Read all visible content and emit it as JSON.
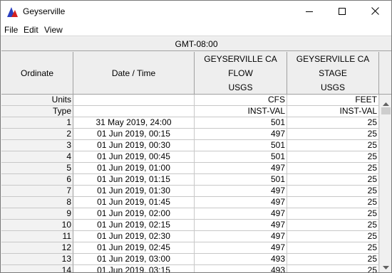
{
  "window": {
    "title": "Geyserville"
  },
  "menu": {
    "file": "File",
    "edit": "Edit",
    "view": "View"
  },
  "timezone": "GMT-08:00",
  "table": {
    "headers": {
      "ordinate": "Ordinate",
      "datetime": "Date / Time",
      "col2": [
        "GEYSERVILLE CA",
        "FLOW",
        "USGS"
      ],
      "col3": [
        "GEYSERVILLE CA",
        "STAGE",
        "USGS"
      ]
    },
    "units": {
      "label": "Units",
      "col2": "CFS",
      "col3": "FEET"
    },
    "type": {
      "label": "Type",
      "col2": "INST-VAL",
      "col3": "INST-VAL"
    },
    "rows": [
      {
        "ord": "1",
        "dt": "31 May 2019, 24:00",
        "flow": "501",
        "stage": "25"
      },
      {
        "ord": "2",
        "dt": "01 Jun 2019, 00:15",
        "flow": "497",
        "stage": "25"
      },
      {
        "ord": "3",
        "dt": "01 Jun 2019, 00:30",
        "flow": "501",
        "stage": "25"
      },
      {
        "ord": "4",
        "dt": "01 Jun 2019, 00:45",
        "flow": "501",
        "stage": "25"
      },
      {
        "ord": "5",
        "dt": "01 Jun 2019, 01:00",
        "flow": "497",
        "stage": "25"
      },
      {
        "ord": "6",
        "dt": "01 Jun 2019, 01:15",
        "flow": "501",
        "stage": "25"
      },
      {
        "ord": "7",
        "dt": "01 Jun 2019, 01:30",
        "flow": "497",
        "stage": "25"
      },
      {
        "ord": "8",
        "dt": "01 Jun 2019, 01:45",
        "flow": "497",
        "stage": "25"
      },
      {
        "ord": "9",
        "dt": "01 Jun 2019, 02:00",
        "flow": "497",
        "stage": "25"
      },
      {
        "ord": "10",
        "dt": "01 Jun 2019, 02:15",
        "flow": "497",
        "stage": "25"
      },
      {
        "ord": "11",
        "dt": "01 Jun 2019, 02:30",
        "flow": "497",
        "stage": "25"
      },
      {
        "ord": "12",
        "dt": "01 Jun 2019, 02:45",
        "flow": "497",
        "stage": "25"
      },
      {
        "ord": "13",
        "dt": "01 Jun 2019, 03:00",
        "flow": "493",
        "stage": "25"
      },
      {
        "ord": "14",
        "dt": "01 Jun 2019, 03:15",
        "flow": "493",
        "stage": "25"
      }
    ]
  },
  "icons": {
    "app": "geyserville-app-icon",
    "minimize": "minimize-icon",
    "maximize": "maximize-icon",
    "close": "close-icon",
    "scroll_up": "scroll-up-arrow-icon",
    "scroll_down": "scroll-down-arrow-icon"
  },
  "colors": {
    "app_icon_blue": "#2a3fbf",
    "app_icon_red": "#d42020"
  }
}
